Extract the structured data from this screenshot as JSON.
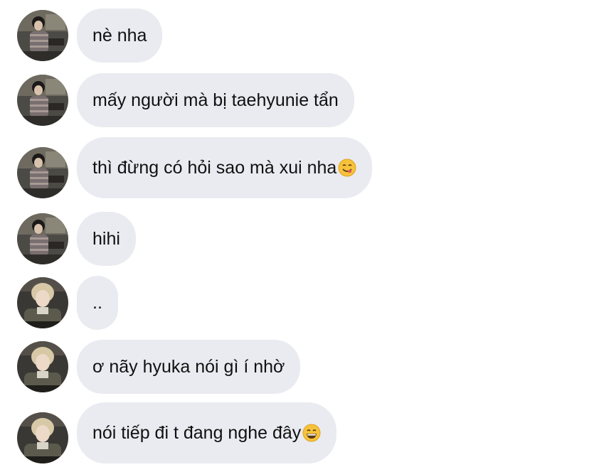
{
  "messages": [
    {
      "sender": "user-a",
      "text": "nè nha",
      "emoji": ""
    },
    {
      "sender": "user-a",
      "text": "mấy người mà bị taehyunie tẩn",
      "emoji": ""
    },
    {
      "sender": "user-a",
      "text": "thì đừng có hỏi sao mà xui nha",
      "emoji": "yum-face-emoji"
    },
    {
      "sender": "user-a",
      "text": "hihi",
      "emoji": ""
    },
    {
      "sender": "user-b",
      "text": "..",
      "emoji": ""
    },
    {
      "sender": "user-b",
      "text": "ơ nãy hyuka nói gì í nhờ",
      "emoji": ""
    },
    {
      "sender": "user-b",
      "text": "nói tiếp đi t đang nghe đây",
      "emoji": "grinning-face-emoji"
    }
  ],
  "colors": {
    "bubble_bg": "#e9ebf0",
    "text": "#111111",
    "background": "#ffffff"
  }
}
